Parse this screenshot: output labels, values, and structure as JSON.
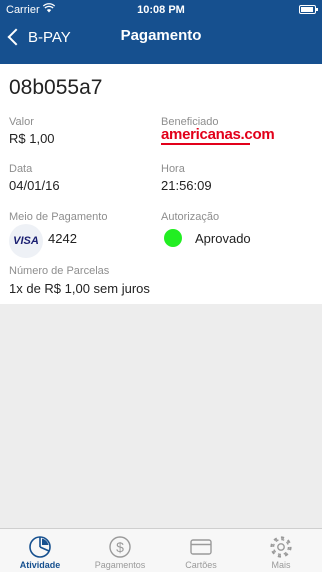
{
  "status_bar": {
    "carrier": "Carrier",
    "time": "10:08 PM"
  },
  "nav": {
    "back_label": "B-PAY",
    "title": "Pagamento"
  },
  "transaction": {
    "id": "08b055a7",
    "valor_label": "Valor",
    "valor": "R$ 1,00",
    "beneficiado_label": "Beneficiado",
    "beneficiado": "americanas.com",
    "data_label": "Data",
    "data": "04/01/16",
    "hora_label": "Hora",
    "hora": "21:56:09",
    "meio_label": "Meio de Pagamento",
    "card_brand": "VISA",
    "card_last4": "4242",
    "autorizacao_label": "Autorização",
    "autorizacao": "Aprovado",
    "parcelas_label": "Número de Parcelas",
    "parcelas": "1x de R$ 1,00 sem juros"
  },
  "colors": {
    "primary": "#16508f",
    "approved": "#22ee22",
    "brand_red": "#e2001a"
  },
  "tabs": [
    {
      "label": "Atividade",
      "icon": "pie-chart-icon",
      "active": true
    },
    {
      "label": "Pagamentos",
      "icon": "dollar-circle-icon",
      "active": false
    },
    {
      "label": "Cartões",
      "icon": "credit-card-icon",
      "active": false
    },
    {
      "label": "Mais",
      "icon": "gear-icon",
      "active": false
    }
  ]
}
